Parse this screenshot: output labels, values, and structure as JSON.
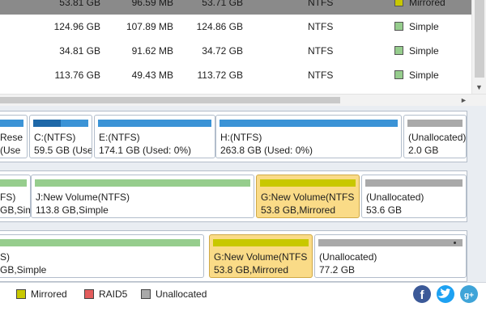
{
  "colors": {
    "simple": "#96cd8d",
    "mirrored": "#c8c800",
    "raid5": "#e35d5d",
    "unallocated": "#a9a9a9",
    "used_bar": "#3b93d6",
    "selected_partition": "#fadb87",
    "facebook": "#3b5998",
    "twitter": "#1da1f2",
    "google_plus": "#3fa4d8"
  },
  "volume_table": {
    "rows": [
      {
        "capacity": "53.81 GB",
        "used": "96.59 MB",
        "free": "53.71 GB",
        "file_system": "NTFS",
        "type": "Mirrored",
        "type_color": "#c8c800",
        "selected": true
      },
      {
        "capacity": "124.96 GB",
        "used": "107.89 MB",
        "free": "124.86 GB",
        "file_system": "NTFS",
        "type": "Simple",
        "type_color": "#96cd8d",
        "selected": false
      },
      {
        "capacity": "34.81 GB",
        "used": "91.62 MB",
        "free": "34.72 GB",
        "file_system": "NTFS",
        "type": "Simple",
        "type_color": "#96cd8d",
        "selected": false
      },
      {
        "capacity": "113.76 GB",
        "used": "49.43 MB",
        "free": "113.72 GB",
        "file_system": "NTFS",
        "type": "Simple",
        "type_color": "#96cd8d",
        "selected": false
      }
    ]
  },
  "disk_map": {
    "disks": [
      {
        "partitions": [
          {
            "line1": "Rese",
            "line2": "(Use",
            "bar": "used",
            "used_fraction": 1.0,
            "selected": false
          },
          {
            "line1": "C:(NTFS)",
            "line2": "59.5 GB (Use",
            "bar": "used",
            "used_fraction": 0.5,
            "selected": false
          },
          {
            "line1": "E:(NTFS)",
            "line2": "174.1 GB (Used: 0%)",
            "bar": "used",
            "used_fraction": 1.0,
            "selected": false
          },
          {
            "line1": "H:(NTFS)",
            "line2": "263.8 GB (Used: 0%)",
            "bar": "used",
            "used_fraction": 1.0,
            "selected": false
          },
          {
            "line1": "(Unallocated)",
            "line2": "2.0 GB",
            "bar": "unallocated",
            "used_fraction": 1.0,
            "selected": false
          }
        ]
      },
      {
        "partitions": [
          {
            "line1": "FS)",
            "line2": "GB,Simp",
            "bar": "simple",
            "used_fraction": 1.0,
            "selected": false
          },
          {
            "line1": "J:New Volume(NTFS)",
            "line2": "113.8 GB,Simple",
            "bar": "simple",
            "used_fraction": 1.0,
            "selected": false
          },
          {
            "line1": "G:New Volume(NTFS",
            "line2": "53.8 GB,Mirrored",
            "bar": "mirrored",
            "used_fraction": 1.0,
            "selected": true
          },
          {
            "line1": "(Unallocated)",
            "line2": "53.6 GB",
            "bar": "unallocated",
            "used_fraction": 1.0,
            "selected": false
          }
        ]
      },
      {
        "partitions": [
          {
            "line1": "S)",
            "line2": "GB,Simple",
            "bar": "simple",
            "used_fraction": 1.0,
            "selected": false
          },
          {
            "line1": "G:New Volume(NTFS",
            "line2": "53.8 GB,Mirrored",
            "bar": "mirrored",
            "used_fraction": 1.0,
            "selected": true
          },
          {
            "line1": "(Unallocated)",
            "line2": "77.2 GB",
            "bar": "unallocated",
            "used_fraction": 1.0,
            "selected": false
          }
        ]
      }
    ]
  },
  "legend": [
    {
      "label": "Mirrored",
      "color": "#c8c800"
    },
    {
      "label": "RAID5",
      "color": "#e35d5d"
    },
    {
      "label": "Unallocated",
      "color": "#a9a9a9"
    }
  ],
  "social": [
    {
      "name": "facebook-icon",
      "color": "#3b5998",
      "glyph": "f"
    },
    {
      "name": "twitter-icon",
      "color": "#1da1f2",
      "glyph": "t"
    },
    {
      "name": "google-plus-icon",
      "color": "#3fa4d8",
      "glyph": "g+"
    }
  ]
}
